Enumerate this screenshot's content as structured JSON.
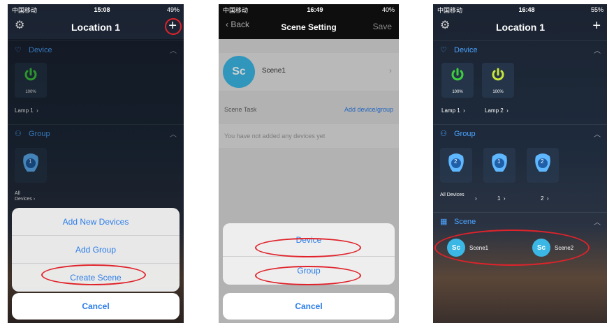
{
  "screen1": {
    "status_time": "15:08",
    "status_left": "中国移动",
    "status_right": "49%",
    "title": "Location 1",
    "device_section": "Device",
    "device_tile_pct": "100%",
    "device_label": "Lamp 1",
    "group_section": "Group",
    "group_badge": "1",
    "group_label_line1": "All",
    "group_label_line2": "Devices",
    "menu": [
      "Add New Devices",
      "Add Group",
      "Create Scene"
    ],
    "cancel": "Cancel"
  },
  "screen2": {
    "status_time": "16:49",
    "status_left": "中国移动",
    "status_right": "40%",
    "back": "Back",
    "title": "Scene Setting",
    "save": "Save",
    "scene_avatar": "Sc",
    "scene_name": "Scene1",
    "task_label": "Scene Task",
    "add_link": "Add device/group",
    "empty_msg": "You have not added any devices yet",
    "menu": [
      "Device",
      "Group"
    ],
    "cancel": "Cancel"
  },
  "screen3": {
    "status_time": "16:48",
    "status_left": "中国移动",
    "status_right": "55%",
    "title": "Location 1",
    "device_section": "Device",
    "devices": [
      {
        "pct": "100%",
        "label": "Lamp 1",
        "color": "#3ecf3e"
      },
      {
        "pct": "100%",
        "label": "Lamp 2",
        "color": "#c8e63a"
      }
    ],
    "group_section": "Group",
    "groups": [
      {
        "badge": "2",
        "label": "All Devices"
      },
      {
        "badge": "1",
        "label": "1"
      },
      {
        "badge": "2",
        "label": "2"
      }
    ],
    "scene_section": "Scene",
    "scenes": [
      {
        "avatar": "Sc",
        "label": "Scene1"
      },
      {
        "avatar": "Sc",
        "label": "Scene2"
      }
    ]
  }
}
